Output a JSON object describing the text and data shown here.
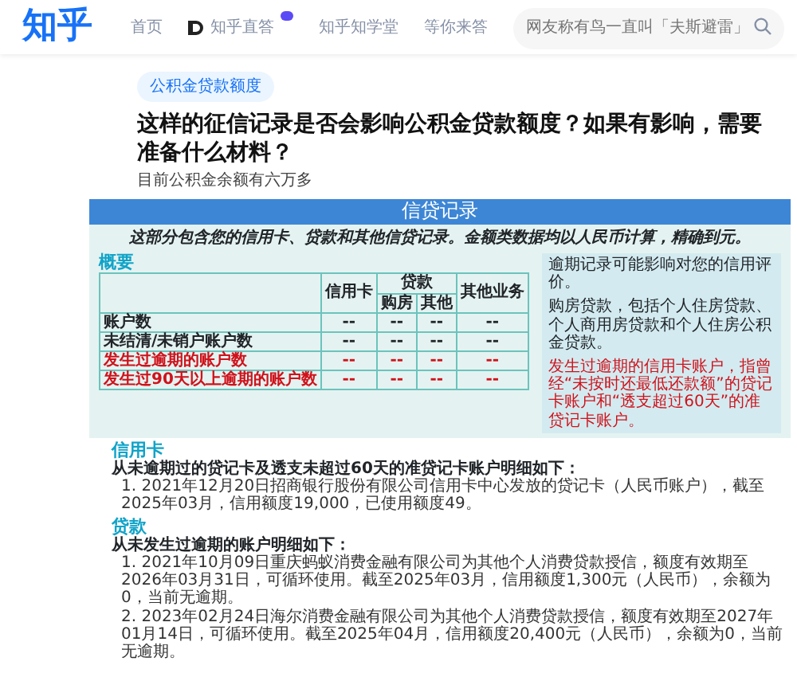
{
  "nav": {
    "logo": "知乎",
    "items": [
      {
        "label": "首页",
        "kind": "link"
      },
      {
        "label": "知乎直答",
        "kind": "featured"
      },
      {
        "label": "知乎知学堂",
        "kind": "link"
      },
      {
        "label": "等你来答",
        "kind": "link"
      }
    ],
    "search": {
      "placeholder": "网友称有鸟一直叫「夫斯避雷」"
    }
  },
  "question": {
    "topic": "公积金贷款额度",
    "title": "这样的征信记录是否会影响公积金贷款额度？如果有影响，需要准备什么材料？",
    "detail": "目前公积金余额有六万多"
  },
  "document": {
    "header": "信贷记录",
    "intro": "这部分包含您的信用卡、贷款和其他信贷记录。金额类数据均以人民币计算，精确到元。",
    "summary_title": "概要",
    "table": {
      "column_group": "贷款",
      "columns": [
        {
          "label": "信用卡",
          "in_group": false
        },
        {
          "label": "购房",
          "in_group": true
        },
        {
          "label": "其他",
          "in_group": true
        },
        {
          "label": "其他业务",
          "in_group": false
        }
      ],
      "rows": [
        {
          "label": "账户数",
          "warning": false,
          "cells": [
            "--",
            "--",
            "--",
            "--"
          ]
        },
        {
          "label": "未结清/未销户账户数",
          "warning": false,
          "cells": [
            "--",
            "--",
            "--",
            "--"
          ]
        },
        {
          "label": "发生过逾期的账户数",
          "warning": true,
          "cells": [
            "--",
            "--",
            "--",
            "--"
          ]
        },
        {
          "label": "发生过90天以上逾期的账户数",
          "warning": true,
          "cells": [
            "--",
            "--",
            "--",
            "--"
          ]
        }
      ]
    },
    "notes": [
      {
        "text": "逾期记录可能影响对您的信用评价。",
        "warning": false
      },
      {
        "text": "购房贷款，包括个人住房贷款、个人商用房贷款和个人住房公积金贷款。",
        "warning": false
      },
      {
        "text": "发生过逾期的信用卡账户，指曾经“未按时还最低还款额”的贷记卡账户和“透支超过60天”的准贷记卡账户。",
        "warning": true
      }
    ],
    "sections": [
      {
        "title": "信用卡",
        "subtitle": "从未逾期过的贷记卡及透支未超过60天的准贷记卡账户明细如下：",
        "items": [
          "1. 2021年12月20日招商银行股份有限公司信用卡中心发放的贷记卡（人民币账户），截至2025年03月，信用额度19,000，已使用额度49。"
        ]
      },
      {
        "title": "贷款",
        "subtitle": "从未发生过逾期的账户明细如下：",
        "items": [
          "1. 2021年10月09日重庆蚂蚁消费金融有限公司为其他个人消费贷款授信，额度有效期至2026年03月31日，可循环使用。截至2025年03月，信用额度1,300元（人民币），余额为0，当前无逾期。",
          "2. 2023年02月24日海尔消费金融有限公司为其他个人消费贷款授信，额度有效期至2027年01月14日，可循环使用。截至2025年04月，信用额度20,400元（人民币），余额为0，当前无逾期。"
        ]
      }
    ]
  }
}
